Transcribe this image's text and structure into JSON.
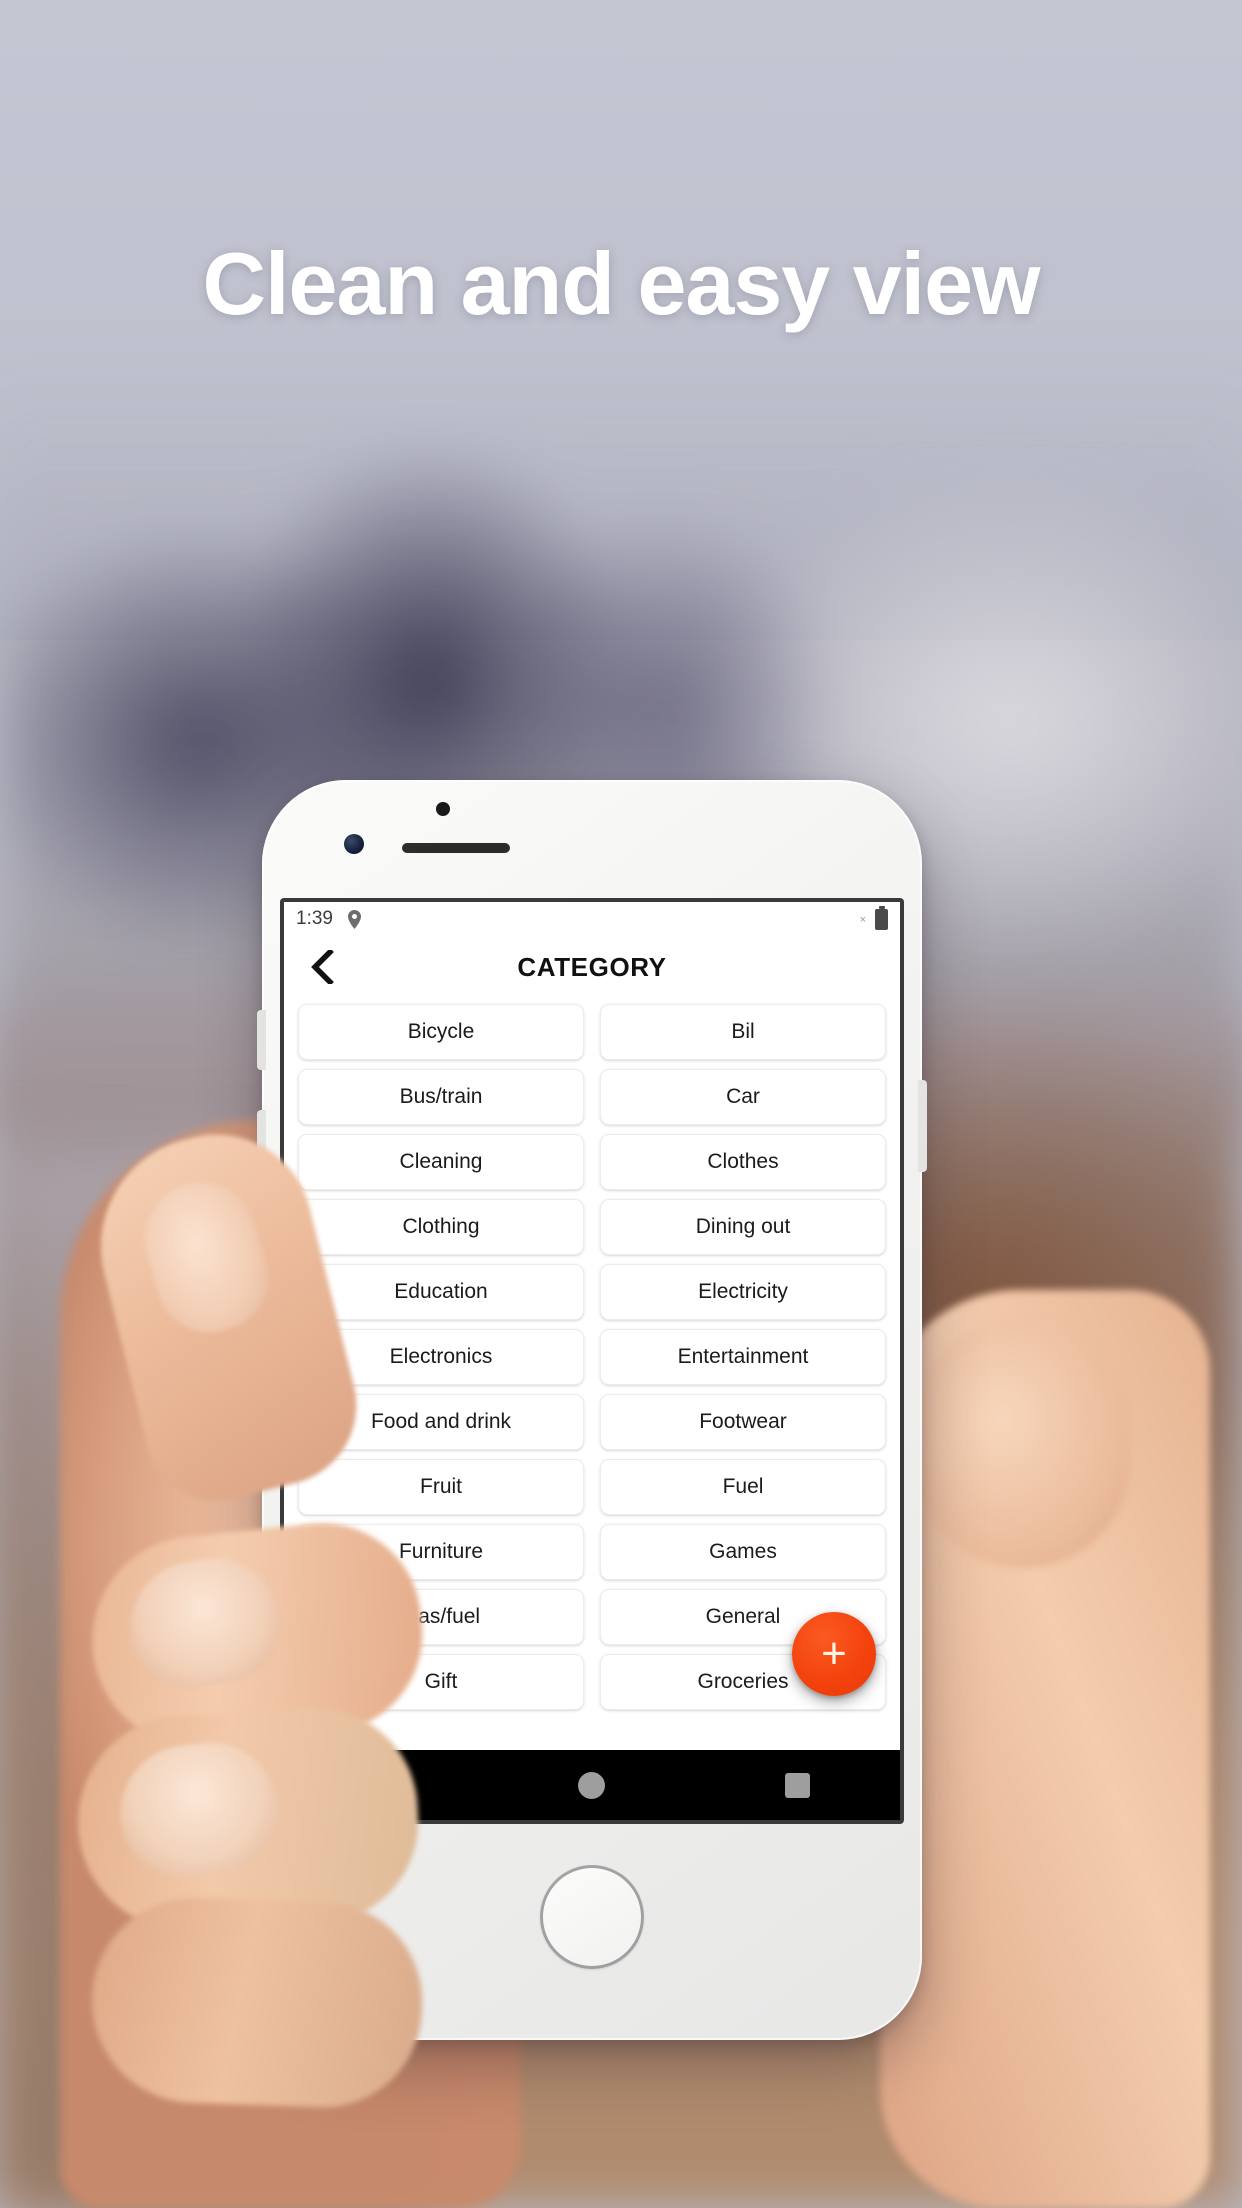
{
  "promo": {
    "headline": "Clean and easy view"
  },
  "phone": {
    "status_bar": {
      "time": "1:39",
      "location_icon": "location-pin-icon",
      "close_marker": "×",
      "battery_icon": "battery-icon"
    },
    "app_bar": {
      "back_icon": "chevron-left-icon",
      "title": "CATEGORY"
    },
    "fab": {
      "icon": "plus-icon",
      "label": "+",
      "color": "#f4430d"
    },
    "nav_bar": {
      "back": "nav-back-triangle-icon",
      "home": "nav-home-circle-icon",
      "recents": "nav-recents-square-icon"
    },
    "categories": [
      "Bicycle",
      "Bil",
      "Bus/train",
      "Car",
      "Cleaning",
      "Clothes",
      "Clothing",
      "Dining out",
      "Education",
      "Electricity",
      "Electronics",
      "Entertainment",
      "Food and drink",
      "Footwear",
      "Fruit",
      "Fuel",
      "Furniture",
      "Games",
      "Gas/fuel",
      "General",
      "Gift",
      "Groceries"
    ]
  },
  "theme": {
    "accent": "#f4430d",
    "headline_color": "#ffffff",
    "screen_bg": "#ffffff",
    "nav_bg": "#000000"
  }
}
